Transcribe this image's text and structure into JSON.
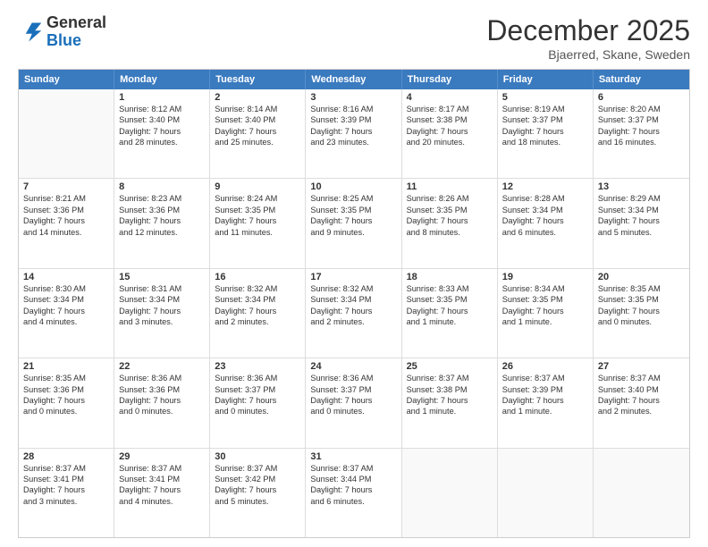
{
  "header": {
    "logo_general": "General",
    "logo_blue": "Blue",
    "title": "December 2025",
    "subtitle": "Bjaerred, Skane, Sweden"
  },
  "days_of_week": [
    "Sunday",
    "Monday",
    "Tuesday",
    "Wednesday",
    "Thursday",
    "Friday",
    "Saturday"
  ],
  "weeks": [
    [
      {
        "day": "",
        "sunrise": "",
        "sunset": "",
        "daylight": ""
      },
      {
        "day": "1",
        "sunrise": "Sunrise: 8:12 AM",
        "sunset": "Sunset: 3:40 PM",
        "daylight": "Daylight: 7 hours and 28 minutes."
      },
      {
        "day": "2",
        "sunrise": "Sunrise: 8:14 AM",
        "sunset": "Sunset: 3:40 PM",
        "daylight": "Daylight: 7 hours and 25 minutes."
      },
      {
        "day": "3",
        "sunrise": "Sunrise: 8:16 AM",
        "sunset": "Sunset: 3:39 PM",
        "daylight": "Daylight: 7 hours and 23 minutes."
      },
      {
        "day": "4",
        "sunrise": "Sunrise: 8:17 AM",
        "sunset": "Sunset: 3:38 PM",
        "daylight": "Daylight: 7 hours and 20 minutes."
      },
      {
        "day": "5",
        "sunrise": "Sunrise: 8:19 AM",
        "sunset": "Sunset: 3:37 PM",
        "daylight": "Daylight: 7 hours and 18 minutes."
      },
      {
        "day": "6",
        "sunrise": "Sunrise: 8:20 AM",
        "sunset": "Sunset: 3:37 PM",
        "daylight": "Daylight: 7 hours and 16 minutes."
      }
    ],
    [
      {
        "day": "7",
        "sunrise": "Sunrise: 8:21 AM",
        "sunset": "Sunset: 3:36 PM",
        "daylight": "Daylight: 7 hours and 14 minutes."
      },
      {
        "day": "8",
        "sunrise": "Sunrise: 8:23 AM",
        "sunset": "Sunset: 3:36 PM",
        "daylight": "Daylight: 7 hours and 12 minutes."
      },
      {
        "day": "9",
        "sunrise": "Sunrise: 8:24 AM",
        "sunset": "Sunset: 3:35 PM",
        "daylight": "Daylight: 7 hours and 11 minutes."
      },
      {
        "day": "10",
        "sunrise": "Sunrise: 8:25 AM",
        "sunset": "Sunset: 3:35 PM",
        "daylight": "Daylight: 7 hours and 9 minutes."
      },
      {
        "day": "11",
        "sunrise": "Sunrise: 8:26 AM",
        "sunset": "Sunset: 3:35 PM",
        "daylight": "Daylight: 7 hours and 8 minutes."
      },
      {
        "day": "12",
        "sunrise": "Sunrise: 8:28 AM",
        "sunset": "Sunset: 3:34 PM",
        "daylight": "Daylight: 7 hours and 6 minutes."
      },
      {
        "day": "13",
        "sunrise": "Sunrise: 8:29 AM",
        "sunset": "Sunset: 3:34 PM",
        "daylight": "Daylight: 7 hours and 5 minutes."
      }
    ],
    [
      {
        "day": "14",
        "sunrise": "Sunrise: 8:30 AM",
        "sunset": "Sunset: 3:34 PM",
        "daylight": "Daylight: 7 hours and 4 minutes."
      },
      {
        "day": "15",
        "sunrise": "Sunrise: 8:31 AM",
        "sunset": "Sunset: 3:34 PM",
        "daylight": "Daylight: 7 hours and 3 minutes."
      },
      {
        "day": "16",
        "sunrise": "Sunrise: 8:32 AM",
        "sunset": "Sunset: 3:34 PM",
        "daylight": "Daylight: 7 hours and 2 minutes."
      },
      {
        "day": "17",
        "sunrise": "Sunrise: 8:32 AM",
        "sunset": "Sunset: 3:34 PM",
        "daylight": "Daylight: 7 hours and 2 minutes."
      },
      {
        "day": "18",
        "sunrise": "Sunrise: 8:33 AM",
        "sunset": "Sunset: 3:35 PM",
        "daylight": "Daylight: 7 hours and 1 minute."
      },
      {
        "day": "19",
        "sunrise": "Sunrise: 8:34 AM",
        "sunset": "Sunset: 3:35 PM",
        "daylight": "Daylight: 7 hours and 1 minute."
      },
      {
        "day": "20",
        "sunrise": "Sunrise: 8:35 AM",
        "sunset": "Sunset: 3:35 PM",
        "daylight": "Daylight: 7 hours and 0 minutes."
      }
    ],
    [
      {
        "day": "21",
        "sunrise": "Sunrise: 8:35 AM",
        "sunset": "Sunset: 3:36 PM",
        "daylight": "Daylight: 7 hours and 0 minutes."
      },
      {
        "day": "22",
        "sunrise": "Sunrise: 8:36 AM",
        "sunset": "Sunset: 3:36 PM",
        "daylight": "Daylight: 7 hours and 0 minutes."
      },
      {
        "day": "23",
        "sunrise": "Sunrise: 8:36 AM",
        "sunset": "Sunset: 3:37 PM",
        "daylight": "Daylight: 7 hours and 0 minutes."
      },
      {
        "day": "24",
        "sunrise": "Sunrise: 8:36 AM",
        "sunset": "Sunset: 3:37 PM",
        "daylight": "Daylight: 7 hours and 0 minutes."
      },
      {
        "day": "25",
        "sunrise": "Sunrise: 8:37 AM",
        "sunset": "Sunset: 3:38 PM",
        "daylight": "Daylight: 7 hours and 1 minute."
      },
      {
        "day": "26",
        "sunrise": "Sunrise: 8:37 AM",
        "sunset": "Sunset: 3:39 PM",
        "daylight": "Daylight: 7 hours and 1 minute."
      },
      {
        "day": "27",
        "sunrise": "Sunrise: 8:37 AM",
        "sunset": "Sunset: 3:40 PM",
        "daylight": "Daylight: 7 hours and 2 minutes."
      }
    ],
    [
      {
        "day": "28",
        "sunrise": "Sunrise: 8:37 AM",
        "sunset": "Sunset: 3:41 PM",
        "daylight": "Daylight: 7 hours and 3 minutes."
      },
      {
        "day": "29",
        "sunrise": "Sunrise: 8:37 AM",
        "sunset": "Sunset: 3:41 PM",
        "daylight": "Daylight: 7 hours and 4 minutes."
      },
      {
        "day": "30",
        "sunrise": "Sunrise: 8:37 AM",
        "sunset": "Sunset: 3:42 PM",
        "daylight": "Daylight: 7 hours and 5 minutes."
      },
      {
        "day": "31",
        "sunrise": "Sunrise: 8:37 AM",
        "sunset": "Sunset: 3:44 PM",
        "daylight": "Daylight: 7 hours and 6 minutes."
      },
      {
        "day": "",
        "sunrise": "",
        "sunset": "",
        "daylight": ""
      },
      {
        "day": "",
        "sunrise": "",
        "sunset": "",
        "daylight": ""
      },
      {
        "day": "",
        "sunrise": "",
        "sunset": "",
        "daylight": ""
      }
    ]
  ]
}
